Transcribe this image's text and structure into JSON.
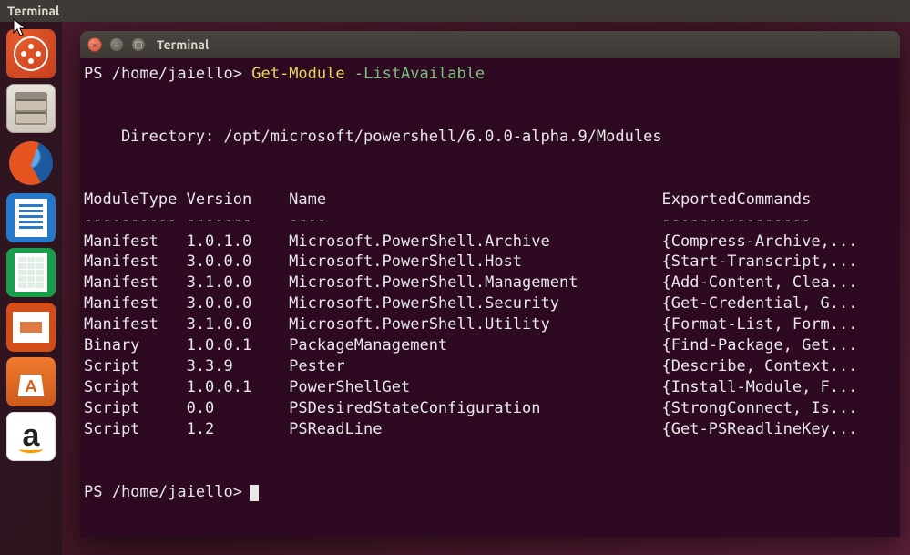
{
  "menubar": {
    "appname": "Terminal"
  },
  "launcher": {
    "items": [
      {
        "name": "dash-icon"
      },
      {
        "name": "files-icon"
      },
      {
        "name": "firefox-icon"
      },
      {
        "name": "writer-icon"
      },
      {
        "name": "calc-icon"
      },
      {
        "name": "impress-icon"
      },
      {
        "name": "software-icon"
      },
      {
        "name": "amazon-icon"
      }
    ]
  },
  "terminal": {
    "title": "Terminal",
    "prompt_user": "PS /home/jaiello>",
    "command": "Get-Module",
    "param": "-ListAvailable",
    "directory_label": "Directory: /opt/microsoft/powershell/6.0.0-alpha.9/Modules",
    "headers": {
      "c0": "ModuleType",
      "c1": "Version",
      "c2": "Name",
      "c3": "ExportedCommands"
    },
    "dashes": {
      "c0": "----------",
      "c1": "-------",
      "c2": "----",
      "c3": "----------------"
    },
    "modules": [
      {
        "type": "Manifest",
        "version": "1.0.1.0",
        "name": "Microsoft.PowerShell.Archive",
        "exported": "{Compress-Archive,..."
      },
      {
        "type": "Manifest",
        "version": "3.0.0.0",
        "name": "Microsoft.PowerShell.Host",
        "exported": "{Start-Transcript,..."
      },
      {
        "type": "Manifest",
        "version": "3.1.0.0",
        "name": "Microsoft.PowerShell.Management",
        "exported": "{Add-Content, Clea..."
      },
      {
        "type": "Manifest",
        "version": "3.0.0.0",
        "name": "Microsoft.PowerShell.Security",
        "exported": "{Get-Credential, G..."
      },
      {
        "type": "Manifest",
        "version": "3.1.0.0",
        "name": "Microsoft.PowerShell.Utility",
        "exported": "{Format-List, Form..."
      },
      {
        "type": "Binary",
        "version": "1.0.0.1",
        "name": "PackageManagement",
        "exported": "{Find-Package, Get..."
      },
      {
        "type": "Script",
        "version": "3.3.9",
        "name": "Pester",
        "exported": "{Describe, Context..."
      },
      {
        "type": "Script",
        "version": "1.0.0.1",
        "name": "PowerShellGet",
        "exported": "{Install-Module, F..."
      },
      {
        "type": "Script",
        "version": "0.0",
        "name": "PSDesiredStateConfiguration",
        "exported": "{StrongConnect, Is..."
      },
      {
        "type": "Script",
        "version": "1.2",
        "name": "PSReadLine",
        "exported": "{Get-PSReadlineKey..."
      }
    ]
  },
  "columns": {
    "c0_w": 11,
    "c1_w": 11,
    "c2_w": 40
  }
}
